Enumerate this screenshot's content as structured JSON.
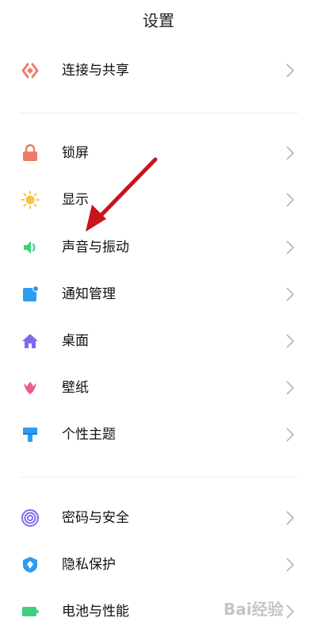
{
  "header": {
    "title": "设置"
  },
  "sections": [
    {
      "items": [
        {
          "label": "连接与共享",
          "icon": "share-icon",
          "color": "#f07a68"
        }
      ]
    },
    {
      "items": [
        {
          "label": "锁屏",
          "icon": "lock-icon",
          "color": "#f07a68"
        },
        {
          "label": "显示",
          "icon": "sun-icon",
          "color": "#f5c542"
        },
        {
          "label": "声音与振动",
          "icon": "speaker-icon",
          "color": "#3ed07c"
        },
        {
          "label": "通知管理",
          "icon": "notification-icon",
          "color": "#2d9bf0"
        },
        {
          "label": "桌面",
          "icon": "home-icon",
          "color": "#7a6cf0"
        },
        {
          "label": "壁纸",
          "icon": "tulip-icon",
          "color": "#ee5b8f"
        },
        {
          "label": "个性主题",
          "icon": "brush-icon",
          "color": "#2d9bf0"
        }
      ]
    },
    {
      "items": [
        {
          "label": "密码与安全",
          "icon": "fingerprint-icon",
          "color": "#7a6cf0"
        },
        {
          "label": "隐私保护",
          "icon": "privacy-shield-icon",
          "color": "#2d9bf0"
        },
        {
          "label": "电池与性能",
          "icon": "battery-icon",
          "color": "#3ed07c"
        }
      ]
    }
  ],
  "watermark": "Bai经验"
}
